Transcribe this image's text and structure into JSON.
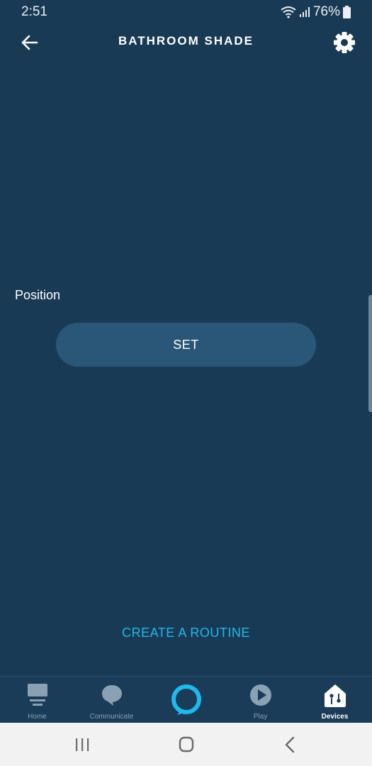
{
  "status_bar": {
    "time": "2:51",
    "battery": "76%"
  },
  "header": {
    "title": "BATHROOM SHADE"
  },
  "controls": {
    "position_label": "Position",
    "set_label": "SET"
  },
  "create_routine_label": "CREATE A ROUTINE",
  "bottom_nav": {
    "items": [
      {
        "label": "Home",
        "icon": "home-icon"
      },
      {
        "label": "Communicate",
        "icon": "speech-bubble-icon"
      },
      {
        "label": "",
        "icon": "alexa-ring-icon"
      },
      {
        "label": "Play",
        "icon": "play-icon"
      },
      {
        "label": "Devices",
        "icon": "devices-icon"
      }
    ],
    "active": "Devices"
  },
  "colors": {
    "background": "#193A55",
    "button": "#2A5677",
    "accent": "#1FB9EB"
  },
  "android_nav": [
    "recents-icon",
    "home-circle-icon",
    "back-chevron-icon"
  ]
}
